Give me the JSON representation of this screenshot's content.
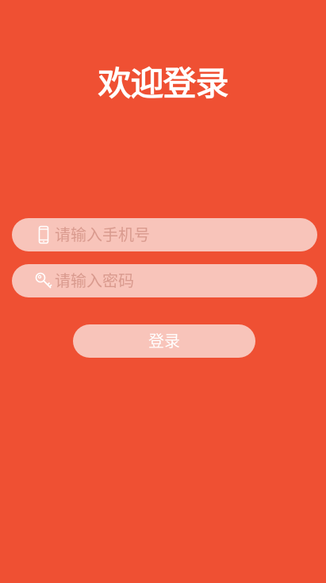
{
  "header": {
    "title": "欢迎登录"
  },
  "form": {
    "phone": {
      "icon": "mobile-phone-icon",
      "placeholder": "请输入手机号",
      "value": ""
    },
    "password": {
      "icon": "key-icon",
      "placeholder": "请输入密码",
      "value": ""
    },
    "submit_label": "登录"
  },
  "colors": {
    "background": "#EF5033",
    "field_background": "#F8C4BA",
    "placeholder": "#D99A8E",
    "text": "#FFFFFF"
  }
}
